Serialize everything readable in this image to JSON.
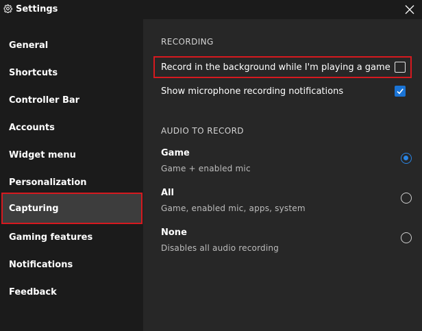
{
  "window": {
    "title": "Settings",
    "title_icon": "gear-icon",
    "close_icon": "close-icon"
  },
  "sidebar": {
    "items": [
      {
        "label": "General",
        "selected": false
      },
      {
        "label": "Shortcuts",
        "selected": false
      },
      {
        "label": "Controller Bar",
        "selected": false
      },
      {
        "label": "Accounts",
        "selected": false
      },
      {
        "label": "Widget menu",
        "selected": false
      },
      {
        "label": "Personalization",
        "selected": false
      },
      {
        "label": "Capturing",
        "selected": true
      },
      {
        "label": "Gaming features",
        "selected": false
      },
      {
        "label": "Notifications",
        "selected": false
      },
      {
        "label": "Feedback",
        "selected": false
      }
    ]
  },
  "recording": {
    "header": "RECORDING",
    "background_recording": {
      "label": "Record in the background while I'm playing a game",
      "checked": false
    },
    "mic_notifications": {
      "label": "Show microphone recording notifications",
      "checked": true
    }
  },
  "audio": {
    "header": "AUDIO TO RECORD",
    "options": [
      {
        "title": "Game",
        "subtitle": "Game + enabled mic",
        "selected": true
      },
      {
        "title": "All",
        "subtitle": "Game, enabled mic, apps, system",
        "selected": false
      },
      {
        "title": "None",
        "subtitle": "Disables all audio recording",
        "selected": false
      }
    ]
  },
  "colors": {
    "accent": "#1a74d6",
    "highlight_border": "#d7191f",
    "selected_nav_bg": "#3d3d3d"
  }
}
